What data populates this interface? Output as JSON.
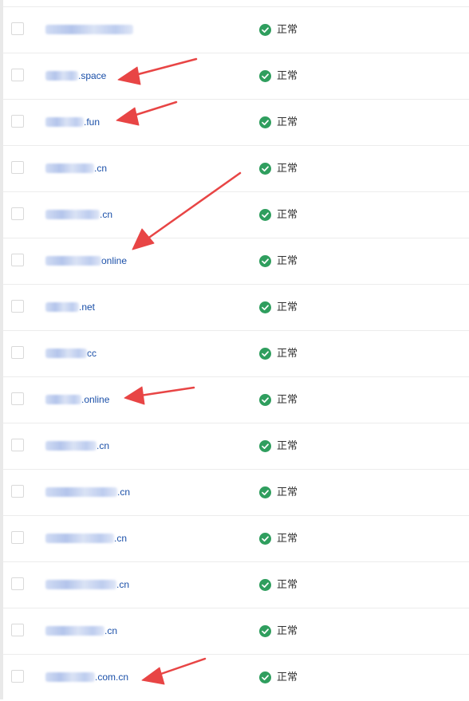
{
  "colors": {
    "link": "#1a4fa8",
    "status_ok": "#2f9e5e",
    "annotation_arrow": "#e84545"
  },
  "icons": {
    "status": "check-circle-icon"
  },
  "rows": [
    {
      "domain_suffix": "",
      "status": "正常"
    },
    {
      "domain_suffix": ".space",
      "status": "正常"
    },
    {
      "domain_suffix": ".fun",
      "status": "正常"
    },
    {
      "domain_suffix": ".cn",
      "status": "正常"
    },
    {
      "domain_suffix": ".cn",
      "status": "正常"
    },
    {
      "domain_suffix": "online",
      "status": "正常"
    },
    {
      "domain_suffix": ".net",
      "status": "正常"
    },
    {
      "domain_suffix": "cc",
      "status": "正常"
    },
    {
      "domain_suffix": ".online",
      "status": "正常"
    },
    {
      "domain_suffix": ".cn",
      "status": "正常"
    },
    {
      "domain_suffix": ".cn",
      "status": "正常"
    },
    {
      "domain_suffix": ".cn",
      "status": "正常"
    },
    {
      "domain_suffix": ".cn",
      "status": "正常"
    },
    {
      "domain_suffix": ".cn",
      "status": "正常"
    },
    {
      "domain_suffix": ".com.cn",
      "status": "正常"
    }
  ]
}
